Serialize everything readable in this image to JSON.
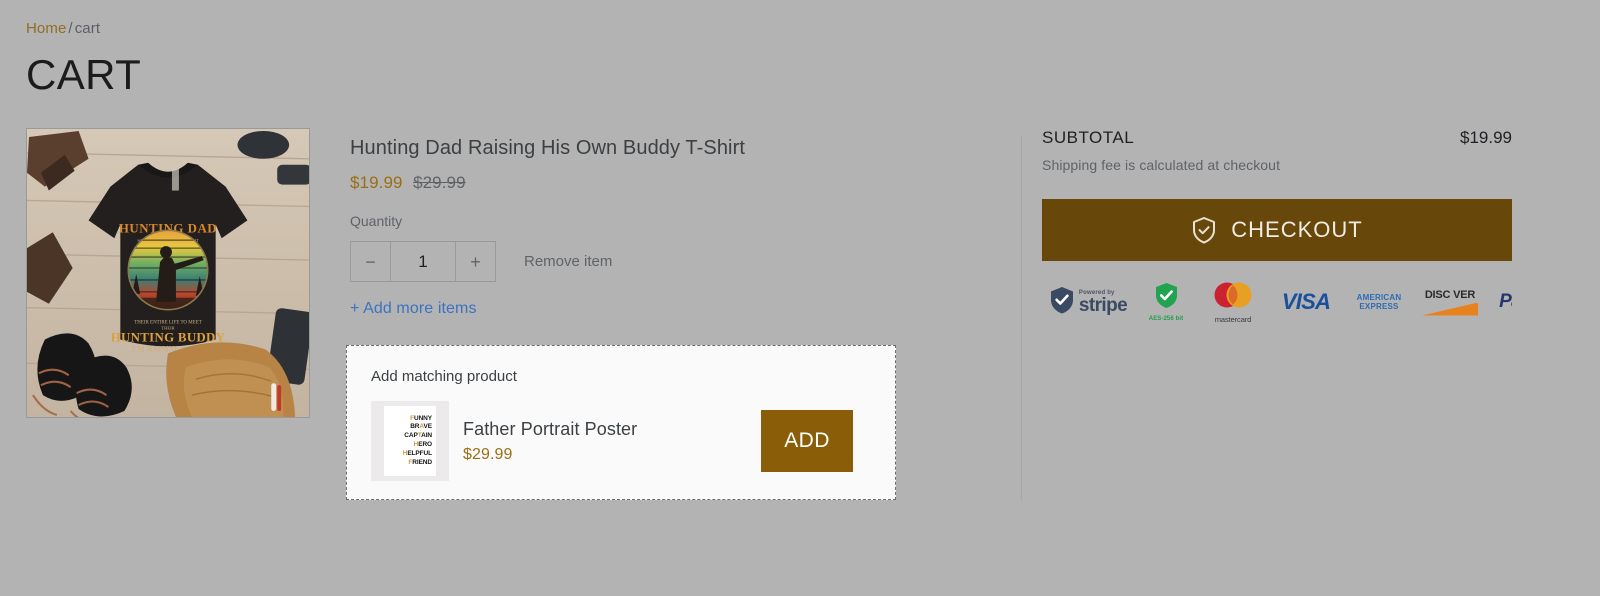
{
  "breadcrumb": {
    "home": "Home",
    "separator": "/",
    "current": "cart"
  },
  "page_title": "CART",
  "cart": {
    "item": {
      "title": "Hunting Dad Raising His Own Buddy T-Shirt",
      "price_now": "$19.99",
      "price_was": "$29.99",
      "quantity_label": "Quantity",
      "quantity_value": "1",
      "decrement_label": "−",
      "increment_label": "+",
      "remove_label": "Remove item",
      "image_alt": "Black Hunting Dad t-shirt flat lay with boots and tan pants on wood planks"
    },
    "add_more_label": "+ Add more items"
  },
  "matching": {
    "heading": "Add matching product",
    "product_name": "Father Portrait Poster",
    "product_price": "$29.99",
    "add_button_label": "ADD",
    "poster_lines": [
      "FUNNY",
      "BRAVE",
      "CAPTAIN",
      "HERO",
      "HELPFUL",
      "FRIEND"
    ]
  },
  "summary": {
    "subtotal_label": "SUBTOTAL",
    "subtotal_value": "$19.99",
    "shipping_note": "Shipping fee is calculated at checkout",
    "checkout_label": "CHECKOUT",
    "checkout_icon": "shield-check-icon"
  },
  "payment_badges": {
    "stripe_powered": "Powered by",
    "stripe_word": "stripe",
    "aes_label": "AES-256 bit",
    "mastercard_label": "mastercard",
    "visa_label": "VISA",
    "amex_line1": "AMERICAN",
    "amex_line2": "EXPRESS",
    "discover_label": "DISC VER",
    "paypal_a": "Pay",
    "paypal_b": "P"
  },
  "colors": {
    "background": "#b3b3b3",
    "accent_gold": "#9a6f14",
    "checkout_brown": "#67470a",
    "add_brown": "#8a5d08",
    "link_blue": "#3a73c4"
  }
}
